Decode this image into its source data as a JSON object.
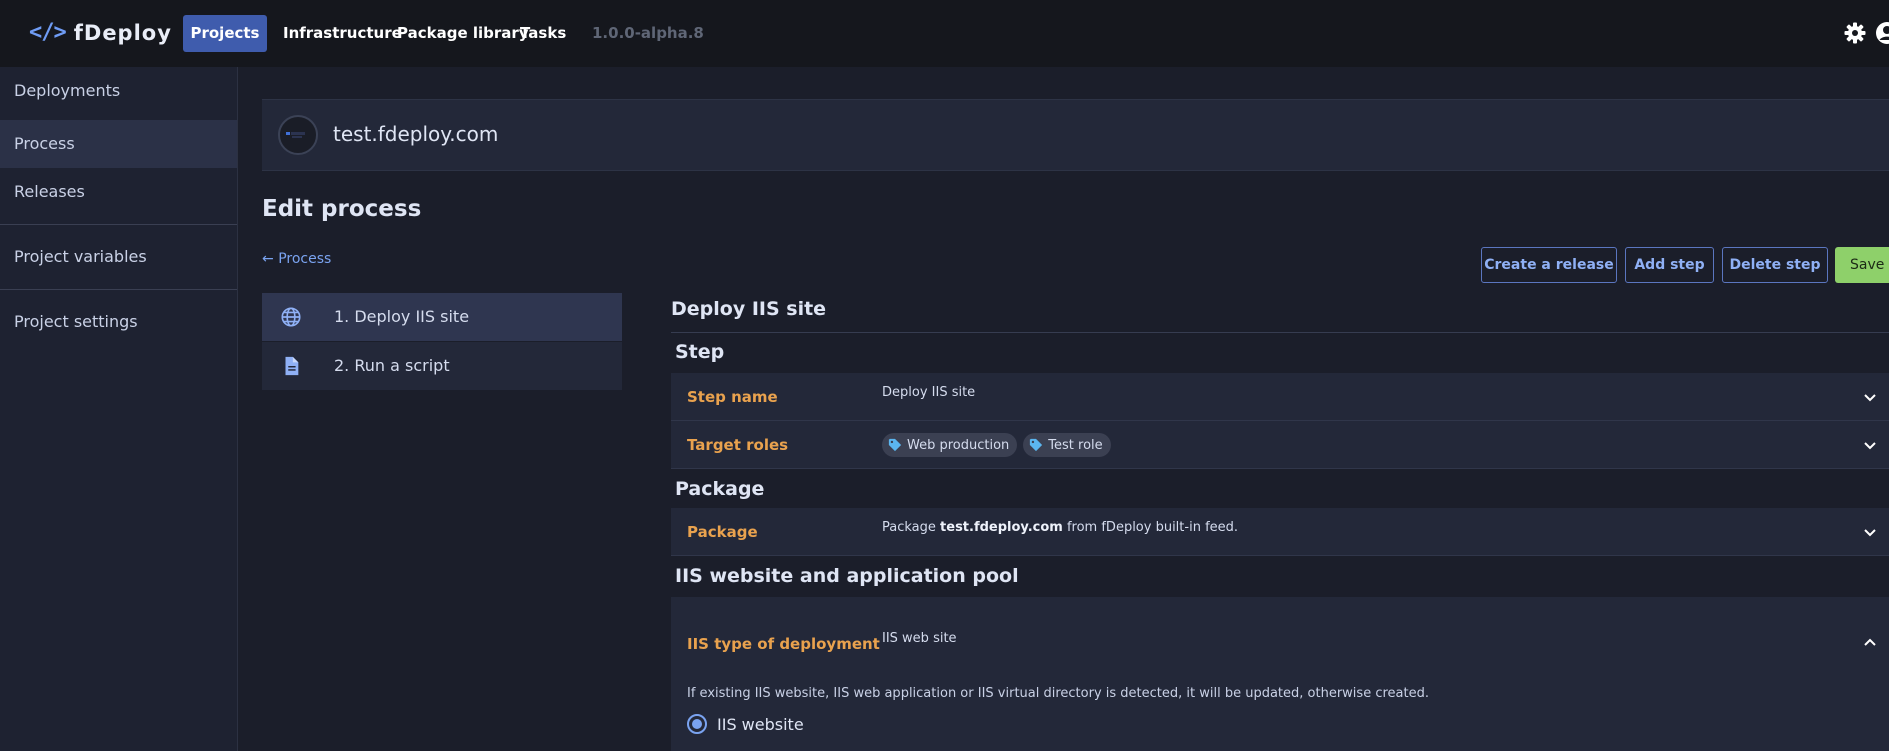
{
  "app": {
    "logo_symbol": "</>",
    "name": "fDeploy"
  },
  "topnav": {
    "items": [
      {
        "label": "Projects",
        "active": true
      },
      {
        "label": "Infrastructure"
      },
      {
        "label": "Package library"
      },
      {
        "label": "Tasks"
      }
    ],
    "version": "1.0.0-alpha.8",
    "icons": [
      "gear-icon",
      "user-icon"
    ]
  },
  "sidebar": {
    "items": [
      {
        "label": "Deployments"
      },
      {
        "label": "Process",
        "active": true
      },
      {
        "label": "Releases"
      },
      {
        "label": "Project variables"
      },
      {
        "label": "Project settings"
      }
    ]
  },
  "project": {
    "name": "test.fdeploy.com"
  },
  "page": {
    "title": "Edit process",
    "back_arrow": "←",
    "back_label": "Process"
  },
  "actions": {
    "create_release": "Create a release",
    "add_step": "Add step",
    "delete_step": "Delete step",
    "save": "Save"
  },
  "steps": [
    {
      "label": "1. Deploy IIS site",
      "icon": "globe-icon",
      "active": true
    },
    {
      "label": "2. Run a script",
      "icon": "document-icon"
    }
  ],
  "detail": {
    "title": "Deploy IIS site",
    "sections": {
      "step": "Step",
      "package": "Package",
      "iis": "IIS website and application pool"
    },
    "step_name": {
      "label": "Step name",
      "value": "Deploy IIS site"
    },
    "target_roles": {
      "label": "Target roles",
      "tags": [
        "Web production",
        "Test role"
      ]
    },
    "package": {
      "label": "Package",
      "prefix": "Package",
      "name": "test.fdeploy.com",
      "suffix": "from fDeploy built-in feed."
    },
    "iis_type": {
      "label": "IIS type of deployment",
      "value": "IIS web site",
      "help": "If existing IIS website, IIS web application or IIS virtual directory is detected, it will be updated, otherwise created.",
      "option": "IIS website"
    }
  },
  "colors": {
    "accent": "#3f5cad",
    "link": "#7aa3f0",
    "label_orange": "#e9a24e",
    "save_green": "#8ed06a"
  }
}
